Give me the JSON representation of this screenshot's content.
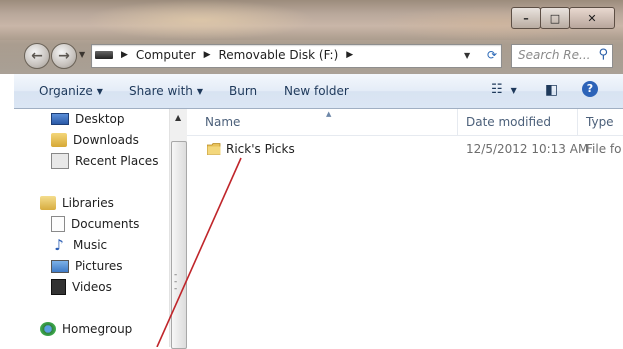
{
  "address_bar": {
    "crumbs": [
      "Computer",
      "Removable Disk (F:)"
    ]
  },
  "search": {
    "placeholder": "Search Re..."
  },
  "toolbar": {
    "organize": "Organize",
    "share_with": "Share with",
    "burn": "Burn",
    "new_folder": "New folder"
  },
  "nav_pane": {
    "favorites": [
      "Desktop",
      "Downloads",
      "Recent Places"
    ],
    "libraries_label": "Libraries",
    "libraries": [
      "Documents",
      "Music",
      "Pictures",
      "Videos"
    ],
    "homegroup": "Homegroup"
  },
  "columns": {
    "name": "Name",
    "date_modified": "Date modified",
    "type": "Type"
  },
  "files": [
    {
      "name": "Rick's Picks",
      "date_modified": "12/5/2012 10:13 AM",
      "type": "File fo"
    }
  ],
  "colors": {
    "annotation_line": "#c0262b",
    "toolbar_text": "#1e395b",
    "folder": "#e7c15a"
  }
}
